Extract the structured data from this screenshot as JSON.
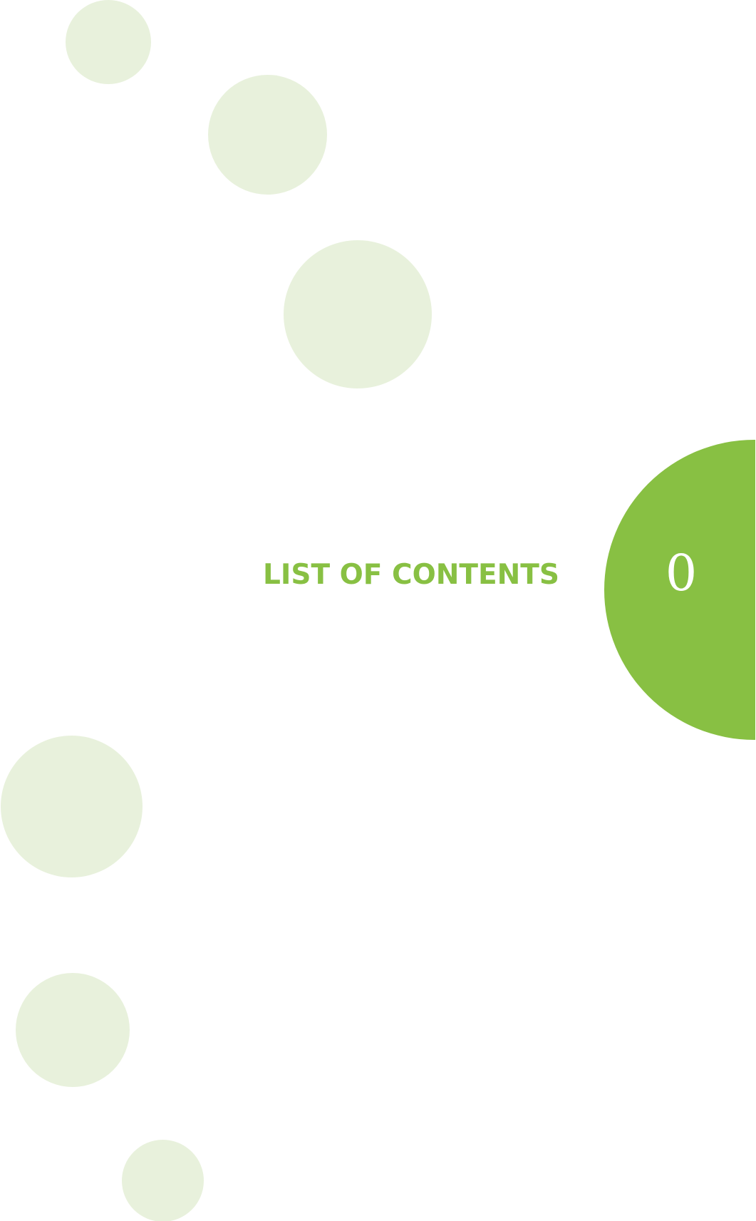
{
  "page": {
    "title": "LIST OF CONTENTS",
    "page_number": "0"
  },
  "colors": {
    "accent": "#88c043",
    "decorative_circle": "#e8f1dc",
    "background": "#ffffff"
  }
}
